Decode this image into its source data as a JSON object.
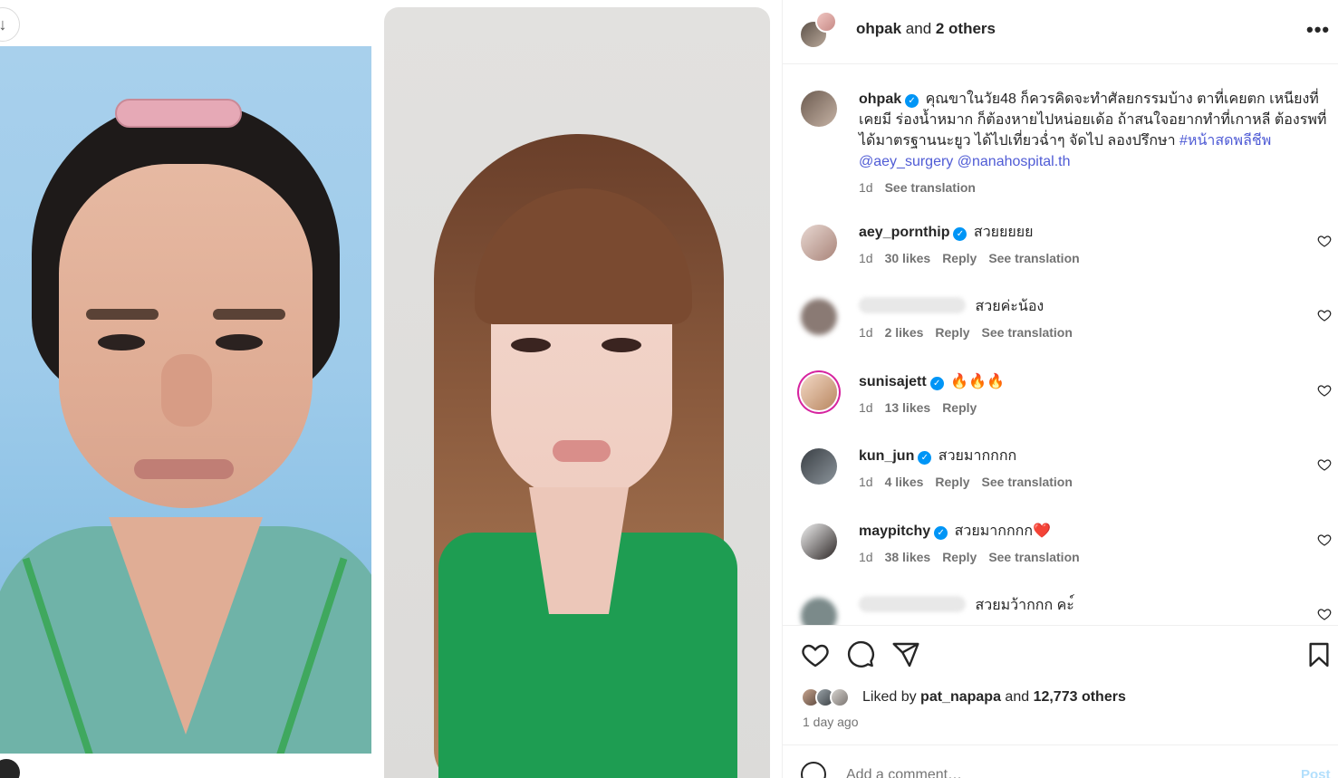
{
  "header": {
    "username": "ohpak",
    "joiner": " and ",
    "others": "2 others",
    "more": "•••"
  },
  "caption": {
    "username": "ohpak",
    "text": "คุณขาในวัย48 ก็ควรคิดจะทำศัลยกรรมบ้าง ตาที่เคยตก เหนียงที่เคยมี ร่องน้ำหมาก ก็ต้องหายไปหน่อยเด้อ ถ้าสนใจอยากทำที่เกาหลี ต้องรพที่ได้มาตรฐานนะยูว ได้ไปเที่ยวฉ่ำๆ จัดไป ลองปรึกษา ",
    "hashtag": "#หน้าสดพลีชีพ",
    "mention1": "@aey_surgery",
    "mention2": "@nanahospital.th",
    "time": "1d",
    "translate": "See translation"
  },
  "comments": [
    {
      "username": "aey_pornthip",
      "verified": true,
      "text": "สวยยยยย",
      "time": "1d",
      "likes": "30 likes",
      "reply": "Reply",
      "translate": "See translation"
    },
    {
      "username": "",
      "verified": false,
      "text": "สวยค่ะน้อง",
      "time": "1d",
      "likes": "2 likes",
      "reply": "Reply",
      "translate": "See translation"
    },
    {
      "username": "sunisajett",
      "verified": true,
      "text": "🔥🔥🔥",
      "time": "1d",
      "likes": "13 likes",
      "reply": "Reply",
      "translate": ""
    },
    {
      "username": "kun_jun",
      "verified": true,
      "text": "สวยมากกกก",
      "time": "1d",
      "likes": "4 likes",
      "reply": "Reply",
      "translate": "See translation"
    },
    {
      "username": "maypitchy",
      "verified": true,
      "text": "สวยมากกกก❤️",
      "time": "1d",
      "likes": "38 likes",
      "reply": "Reply",
      "translate": "See translation"
    },
    {
      "username": "",
      "verified": false,
      "text": "สวยมว้ากกก คะ์",
      "time": "",
      "likes": "",
      "reply": "",
      "translate": ""
    }
  ],
  "likes": {
    "prefix": "Liked by ",
    "user": "pat_napapa",
    "joiner": " and ",
    "count": "12,773 others"
  },
  "posted": "1 day ago",
  "add_comment": {
    "placeholder": "Add a comment…",
    "post_label": "Post"
  },
  "icons": {
    "like": "heart-icon",
    "comment": "comment-icon",
    "share": "share-icon",
    "save": "bookmark-icon",
    "more": "more-icon",
    "emoji": "emoji-icon",
    "download": "download-icon"
  },
  "colors": {
    "verified": "#0095f6",
    "hashtag": "#4f5bd5",
    "secondary_text": "#737373",
    "post_button": "#b2dffc"
  }
}
